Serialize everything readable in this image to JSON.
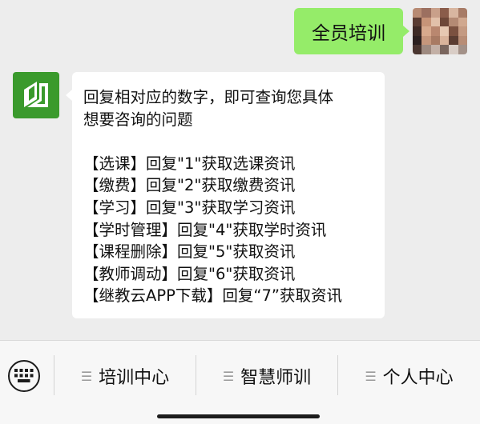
{
  "outgoing": {
    "text": "全员培训"
  },
  "incoming": {
    "intro": [
      "回复相对应的数字，即可查询您具体",
      "想要咨询的问题"
    ],
    "options": [
      "【选课】回复\"1\"获取选课资讯",
      "【缴费】回复\"2\"获取缴费资讯",
      "【学习】回复\"3\"获取学习资讯",
      "【学时管理】回复\"4\"获取学时资讯",
      "【课程删除】回复\"5\"获取资讯",
      "【教师调动】回复\"6\"获取资讯",
      "【继教云APP下载】回复“7”获取资讯"
    ]
  },
  "menu": {
    "keyboard_icon": "keyboard-icon",
    "items": [
      {
        "label": "培训中心",
        "icon": "menu-lines-icon"
      },
      {
        "label": "智慧师训",
        "icon": "menu-lines-icon"
      },
      {
        "label": "个人中心",
        "icon": "menu-lines-icon"
      }
    ]
  },
  "colors": {
    "chat_background": "#ededed",
    "outgoing_bubble": "#95ec69",
    "incoming_bubble": "#ffffff",
    "bot_avatar": "#3a9a2c",
    "menubar": "#f7f7f7"
  }
}
